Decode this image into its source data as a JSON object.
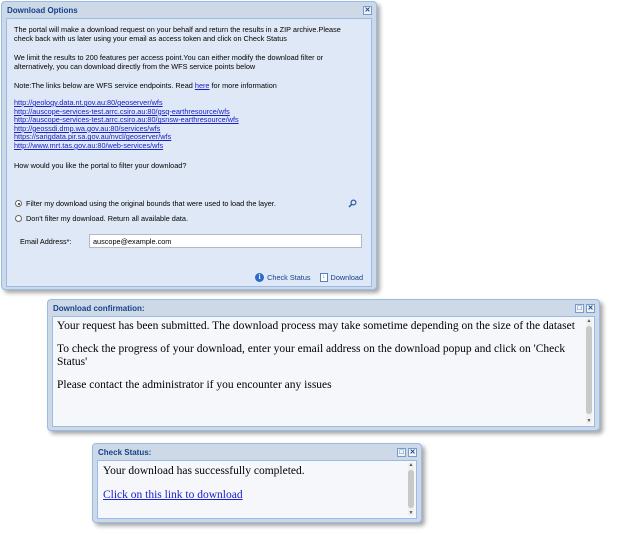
{
  "download_options": {
    "title": "Download Options",
    "para1": "The portal will make a download request on your behalf and return the results in a ZIP archive.Please check back with us later using your email as access token and click on Check Status",
    "para2": "We limit the results to 200 features per access point.You can either modify the download filter or alternatively, you can download directly from the WFS service points below",
    "note_prefix": "Note:The links below are WFS service endpoints. Read ",
    "note_link": "here",
    "note_suffix": " for more information",
    "links": [
      "http://geology.data.nt.gov.au:80/geoserver/wfs",
      "http://auscope-services-test.arrc.csiro.au:80/gsq-earthresource/wfs",
      "http://auscope-services-test.arrc.csiro.au:80/gsnsw-earthresource/wfs",
      "http://geossdi.dmp.wa.gov.au:80/services/wfs",
      "https://sarigdata.pir.sa.gov.au/nvcl/geoserver/wfs",
      "http://www.mrt.tas.gov.au:80/web-services/wfs"
    ],
    "question": "How would you like the portal to filter your download?",
    "option_filter": "Filter my download using the original bounds that were used to load the layer.",
    "option_no_filter": "Don't filter my download. Return all available data.",
    "email_label": "Email Address*:",
    "email_value": "auscope@example.com",
    "check_status_label": "Check Status",
    "download_label": "Download"
  },
  "download_confirmation": {
    "title": "Download confirmation:",
    "line1": "Your request has been submitted. The download process may take sometime depending on the size of the dataset",
    "line2": "To check the progress of your download, enter your email address on the download popup and click on 'Check Status'",
    "line3": "Please contact the administrator if you encounter any issues"
  },
  "check_status": {
    "title": "Check Status:",
    "message": "Your download has successfully completed.",
    "link": "Click on this link to download"
  }
}
